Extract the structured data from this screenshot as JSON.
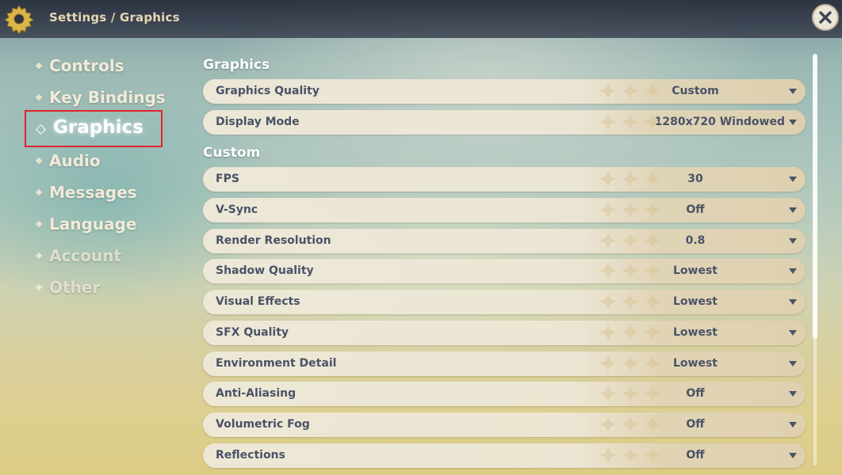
{
  "header": {
    "breadcrumb": "Settings / Graphics"
  },
  "sidebar": {
    "items": [
      {
        "label": "Controls"
      },
      {
        "label": "Key Bindings"
      },
      {
        "label": "Graphics"
      },
      {
        "label": "Audio"
      },
      {
        "label": "Messages"
      },
      {
        "label": "Language"
      },
      {
        "label": "Account"
      },
      {
        "label": "Other"
      }
    ],
    "active": "Graphics"
  },
  "main": {
    "sections": [
      {
        "title": "Graphics",
        "settings": [
          {
            "name": "Graphics Quality",
            "value": "Custom"
          },
          {
            "name": "Display Mode",
            "value": "1280x720 Windowed"
          }
        ]
      },
      {
        "title": "Custom",
        "settings": [
          {
            "name": "FPS",
            "value": "30"
          },
          {
            "name": "V-Sync",
            "value": "Off"
          },
          {
            "name": "Render Resolution",
            "value": "0.8"
          },
          {
            "name": "Shadow Quality",
            "value": "Lowest"
          },
          {
            "name": "Visual Effects",
            "value": "Lowest"
          },
          {
            "name": "SFX Quality",
            "value": "Lowest"
          },
          {
            "name": "Environment Detail",
            "value": "Lowest"
          },
          {
            "name": "Anti-Aliasing",
            "value": "Off"
          },
          {
            "name": "Volumetric Fog",
            "value": "Off"
          },
          {
            "name": "Reflections",
            "value": "Off"
          }
        ]
      }
    ]
  },
  "colors": {
    "accent_text": "#4a5366",
    "highlight_border": "#e0252b",
    "row_background": "#ece6d5"
  },
  "icons": {
    "settings": "gear-icon",
    "close": "close-icon",
    "dropdown": "chevron-down-icon"
  }
}
